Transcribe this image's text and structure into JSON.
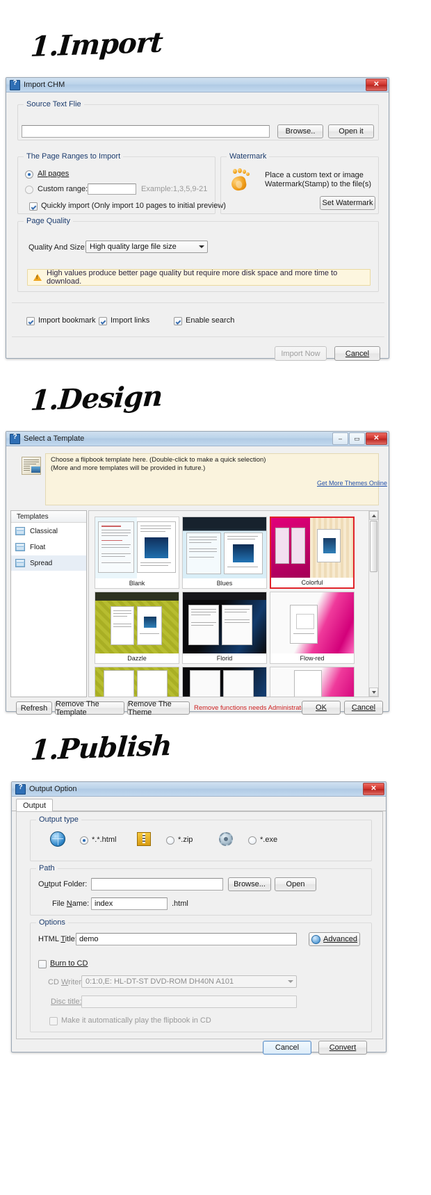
{
  "headings": {
    "import": "1.Import",
    "design": "1.Design",
    "publish": "1.Publish"
  },
  "import_dialog": {
    "title": "Import CHM",
    "close_label": "✕",
    "source_group": "Source Text Flie",
    "source_value": "",
    "browse_button": "Browse..",
    "open_button": "Open it",
    "page_ranges_group": "The Page Ranges to Import",
    "all_pages_label": "All pages",
    "custom_range_label": "Custom range:",
    "custom_range_value": "",
    "example_text": "Example:1,3,5,9-21",
    "quickly_import_label": "Quickly import (Only import 10 pages to  initial  preview)",
    "watermark_group": "Watermark",
    "watermark_desc_line1": "Place a custom text or image",
    "watermark_desc_line2": "Watermark(Stamp) to the file(s)",
    "set_watermark_button": "Set Watermark",
    "page_quality_group": "Page Quality",
    "quality_label": "Quality And Size:",
    "quality_value": "High quality large file size",
    "warning_text": "High values produce better page quality but require more disk space and more time to download.",
    "import_bookmark_label": "Import bookmark",
    "import_links_label": "Import links",
    "enable_search_label": "Enable search",
    "import_now_button": "Import Now",
    "cancel_button": "Cancel"
  },
  "design_dialog": {
    "title": "Select a Template",
    "minimize_label": "–",
    "maximize_label": "▭",
    "close_label": "✕",
    "info_line1": "Choose a flipbook template here. (Double-click to make a quick selection)",
    "info_line2": "(More and more templates will be provided in future.)",
    "get_themes_link": "Get More Themes Online",
    "templates_column_header": "Templates",
    "sidebar_items": [
      {
        "label": "Classical",
        "selected": false
      },
      {
        "label": "Float",
        "selected": false
      },
      {
        "label": "Spread",
        "selected": true
      }
    ],
    "templates": [
      {
        "name": "Blank",
        "selected": false
      },
      {
        "name": "Blues",
        "selected": false
      },
      {
        "name": "Colorful",
        "selected": true
      },
      {
        "name": "Dazzle",
        "selected": false
      },
      {
        "name": "Florid",
        "selected": false
      },
      {
        "name": "Flow-red",
        "selected": false
      }
    ],
    "refresh_button": "Refresh",
    "remove_template_button": "Remove The Template",
    "remove_theme_button": "Remove The Theme",
    "admin_note": "Remove functions needs Administrator rights!",
    "ok_button": "OK",
    "cancel_button": "Cancel"
  },
  "publish_dialog": {
    "title": "Output Option",
    "close_label": "✕",
    "tab_output": "Output",
    "output_type_group": "Output type",
    "output_types": [
      {
        "label": "*.html",
        "selected": true,
        "icon": "globe-icon"
      },
      {
        "label": "*.zip",
        "selected": false,
        "icon": "zip-icon"
      },
      {
        "label": "*.exe",
        "selected": false,
        "icon": "exe-icon"
      }
    ],
    "path_group": "Path",
    "output_folder_label": "Output Folder:",
    "output_folder_value": "",
    "browse_button": "Browse...",
    "open_button": "Open",
    "file_name_label": "File Name:",
    "file_name_value": "index",
    "file_ext_label": ".html",
    "options_group": "Options",
    "html_title_label": "HTML Title:",
    "html_title_value": "demo",
    "advanced_button": "Advanced",
    "burn_to_cd_label": "Burn to CD",
    "cd_writer_label": "CD Writer:",
    "cd_writer_value": "0:1:0,E: HL-DT-ST DVD-ROM DH40N   A101",
    "disc_title_label": "Disc title:",
    "disc_title_value": "",
    "auto_play_label": "Make it automatically play the flipbook in CD",
    "cancel_button": "Cancel",
    "convert_button": "Convert"
  },
  "colors": {
    "titlebar": "#bcd4ea",
    "accent_link": "#2350a8",
    "warning_bg": "#fdf6df",
    "selection_red": "#e0232a",
    "admin_note_red": "#cc1f1f"
  }
}
